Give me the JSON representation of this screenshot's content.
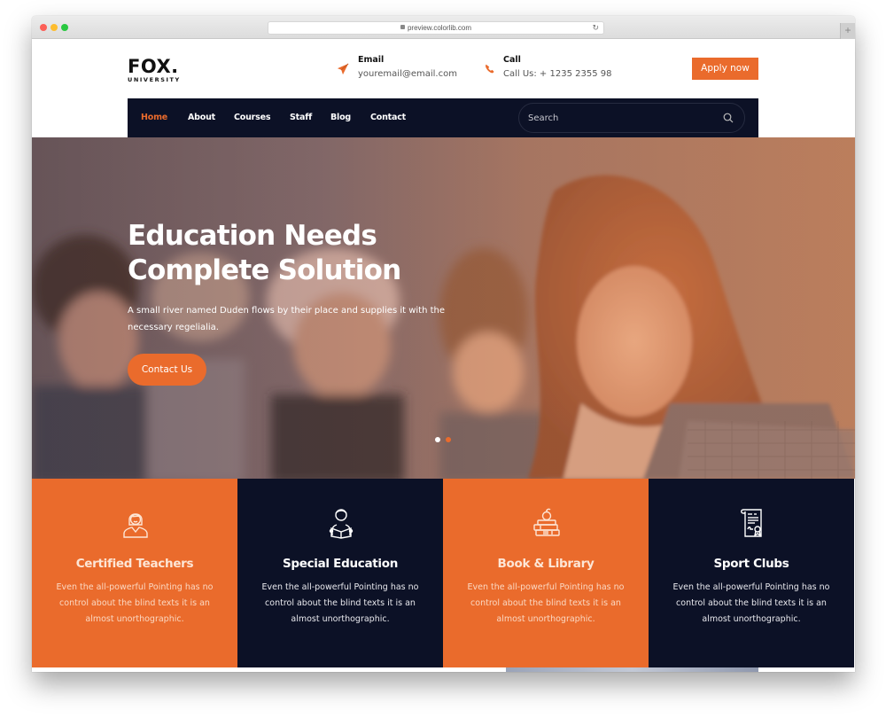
{
  "browser": {
    "url": "preview.colorlib.com",
    "new_tab_label": "+"
  },
  "header": {
    "logo": {
      "main": "FOX.",
      "sub": "UNIVERSITY"
    },
    "email": {
      "label": "Email",
      "value": "youremail@email.com",
      "icon": "paper-plane-icon"
    },
    "call": {
      "label": "Call",
      "value": "Call Us: + 1235 2355 98",
      "icon": "phone-icon"
    },
    "apply_label": "Apply now"
  },
  "nav": {
    "items": [
      {
        "label": "Home",
        "active": true
      },
      {
        "label": "About"
      },
      {
        "label": "Courses"
      },
      {
        "label": "Staff"
      },
      {
        "label": "Blog"
      },
      {
        "label": "Contact"
      }
    ],
    "search_placeholder": "Search"
  },
  "hero": {
    "title_line1": "Education Needs",
    "title_line2": "Complete Solution",
    "subtitle": "A small river named Duden flows by their place and supplies it with the necessary regelialia.",
    "cta_label": "Contact Us",
    "slides": {
      "count": 2,
      "active": 1
    }
  },
  "features": [
    {
      "title": "Certified Teachers",
      "text": "Even the all-powerful Pointing has no control about the blind texts it is an almost unorthographic.",
      "icon": "teacher-icon",
      "theme": "orange"
    },
    {
      "title": "Special Education",
      "text": "Even the all-powerful Pointing has no control about the blind texts it is an almost unorthographic.",
      "icon": "student-reading-icon",
      "theme": "navy"
    },
    {
      "title": "Book & Library",
      "text": "Even the all-powerful Pointing has no control about the blind texts it is an almost unorthographic.",
      "icon": "books-apple-icon",
      "theme": "orange"
    },
    {
      "title": "Sport Clubs",
      "text": "Even the all-powerful Pointing has no control about the blind texts it is an almost unorthographic.",
      "icon": "certificate-icon",
      "theme": "navy"
    }
  ],
  "colors": {
    "accent": "#ea6b2c",
    "navy": "#0c1126",
    "text_dark": "#111111"
  }
}
